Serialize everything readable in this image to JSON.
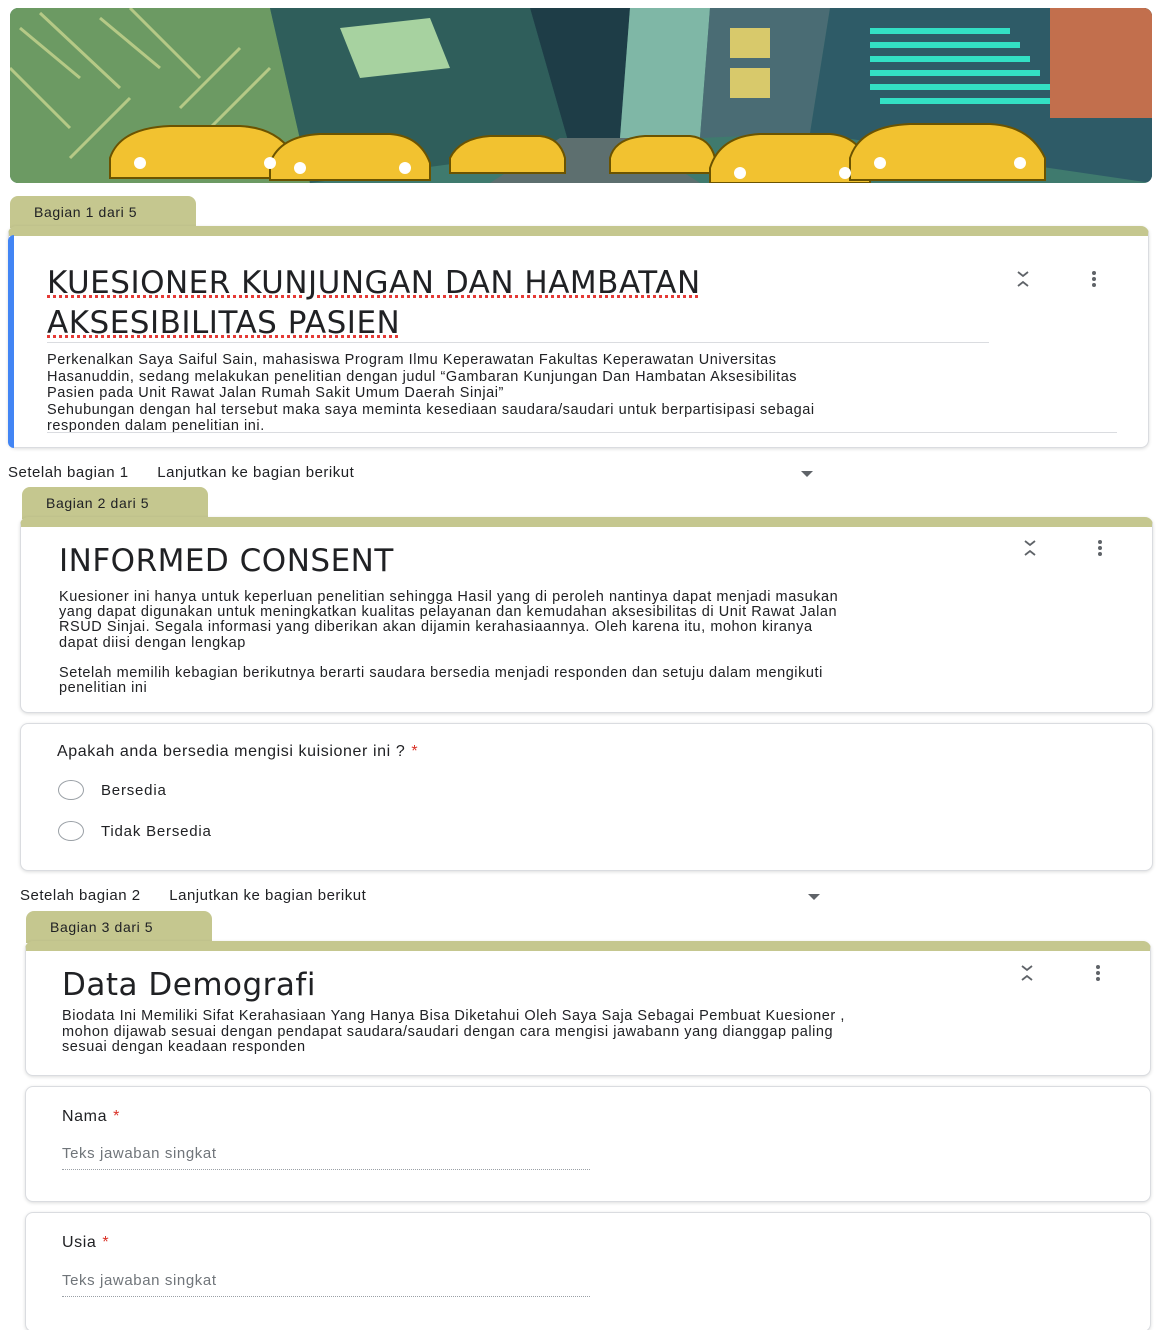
{
  "sections": [
    {
      "tab": "Bagian 1 dari 5",
      "title_line1": "KUESIONER KUNJUNGAN DAN HAMBATAN",
      "title_line2": "AKSESIBILITAS PASIEN",
      "description": [
        "Perkenalkan Saya Saiful Sain, mahasiswa Program Ilmu Keperawatan Fakultas Keperawatan Universitas",
        "Hasanuddin, sedang melakukan penelitian dengan judul “Gambaran Kunjungan Dan Hambatan Aksesibilitas",
        "Pasien pada Unit Rawat Jalan Rumah Sakit Umum Daerah Sinjai”",
        "Sehubungan dengan hal tersebut maka saya meminta kesediaan saudara/saudari untuk berpartisipasi sebagai",
        "responden dalam penelitian ini."
      ],
      "after_label": "Setelah bagian 1",
      "after_value": "Lanjutkan ke bagian berikut"
    },
    {
      "tab": "Bagian 2 dari 5",
      "title": "INFORMED CONSENT",
      "description": [
        "Kuesioner ini hanya untuk keperluan penelitian sehingga Hasil yang di peroleh nantinya dapat menjadi masukan",
        "yang dapat digunakan untuk meningkatkan kualitas pelayanan dan kemudahan aksesibilitas di Unit Rawat Jalan",
        "RSUD Sinjai. Segala informasi yang diberikan akan dijamin  kerahasiaannya. Oleh karena itu, mohon kiranya",
        "dapat diisi dengan lengkap",
        "",
        "Setelah memilih kebagian berikutnya berarti saudara bersedia menjadi responden dan setuju dalam mengikuti",
        "penelitian ini"
      ],
      "question": "Apakah anda bersedia mengisi kuisioner ini ?",
      "required_mark": "*",
      "options": [
        "Bersedia",
        "Tidak Bersedia"
      ],
      "after_label": "Setelah bagian 2",
      "after_value": "Lanjutkan ke bagian berikut"
    },
    {
      "tab": "Bagian 3 dari 5",
      "title": "Data Demografi",
      "description": [
        "Biodata Ini Memiliki Sifat Kerahasiaan Yang Hanya Bisa Diketahui Oleh Saya Saja Sebagai Pembuat Kuesioner ,",
        "mohon dijawab sesuai dengan pendapat saudara/saudari dengan cara mengisi jawabann yang dianggap paling",
        "sesuai dengan keadaan responden"
      ],
      "questions": [
        {
          "label": "Nama",
          "required_mark": "*",
          "placeholder": "Teks jawaban singkat"
        },
        {
          "label": "Usia",
          "required_mark": "*",
          "placeholder": "Teks jawaban singkat"
        }
      ]
    }
  ],
  "colors": {
    "section_tab": "#c5c78f",
    "accent": "#4285f4",
    "required": "#d93025"
  },
  "icons": {
    "collapse": "collapse-icon",
    "more": "more-vert-icon"
  }
}
